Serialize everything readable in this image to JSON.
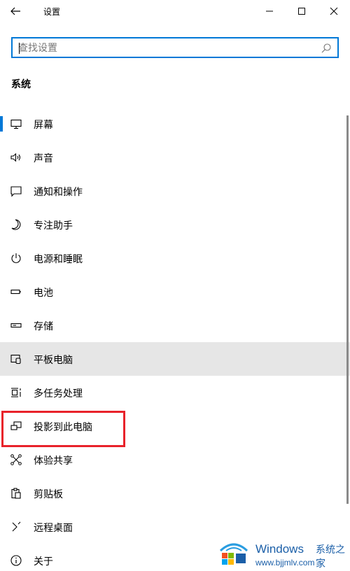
{
  "window": {
    "title": "设置",
    "back_icon": "back-arrow-icon",
    "minimize_icon": "minimize-icon",
    "maximize_icon": "maximize-icon",
    "close_icon": "close-icon"
  },
  "search": {
    "placeholder": "查找设置",
    "value": "",
    "icon": "search-icon"
  },
  "section": {
    "title": "系统"
  },
  "nav": {
    "items": [
      {
        "label": "屏幕",
        "icon": "display-icon",
        "selected": true
      },
      {
        "label": "声音",
        "icon": "speaker-icon"
      },
      {
        "label": "通知和操作",
        "icon": "notification-icon"
      },
      {
        "label": "专注助手",
        "icon": "moon-icon"
      },
      {
        "label": "电源和睡眠",
        "icon": "power-icon"
      },
      {
        "label": "电池",
        "icon": "battery-icon"
      },
      {
        "label": "存储",
        "icon": "storage-icon"
      },
      {
        "label": "平板电脑",
        "icon": "tablet-icon",
        "hovered": true
      },
      {
        "label": "多任务处理",
        "icon": "multitasking-icon"
      },
      {
        "label": "投影到此电脑",
        "icon": "projecting-icon",
        "annotated": true
      },
      {
        "label": "体验共享",
        "icon": "shared-experiences-icon"
      },
      {
        "label": "剪贴板",
        "icon": "clipboard-icon"
      },
      {
        "label": "远程桌面",
        "icon": "remote-desktop-icon"
      },
      {
        "label": "关于",
        "icon": "info-icon"
      }
    ]
  },
  "colors": {
    "accent": "#0078d7",
    "hover_bg": "#e6e6e6",
    "annotation": "#e8222a",
    "watermark": "#1b5fa8"
  },
  "watermark": {
    "brand": "Windows",
    "brand_cn": "系统之家",
    "url": "www.bjjmlv.com"
  }
}
